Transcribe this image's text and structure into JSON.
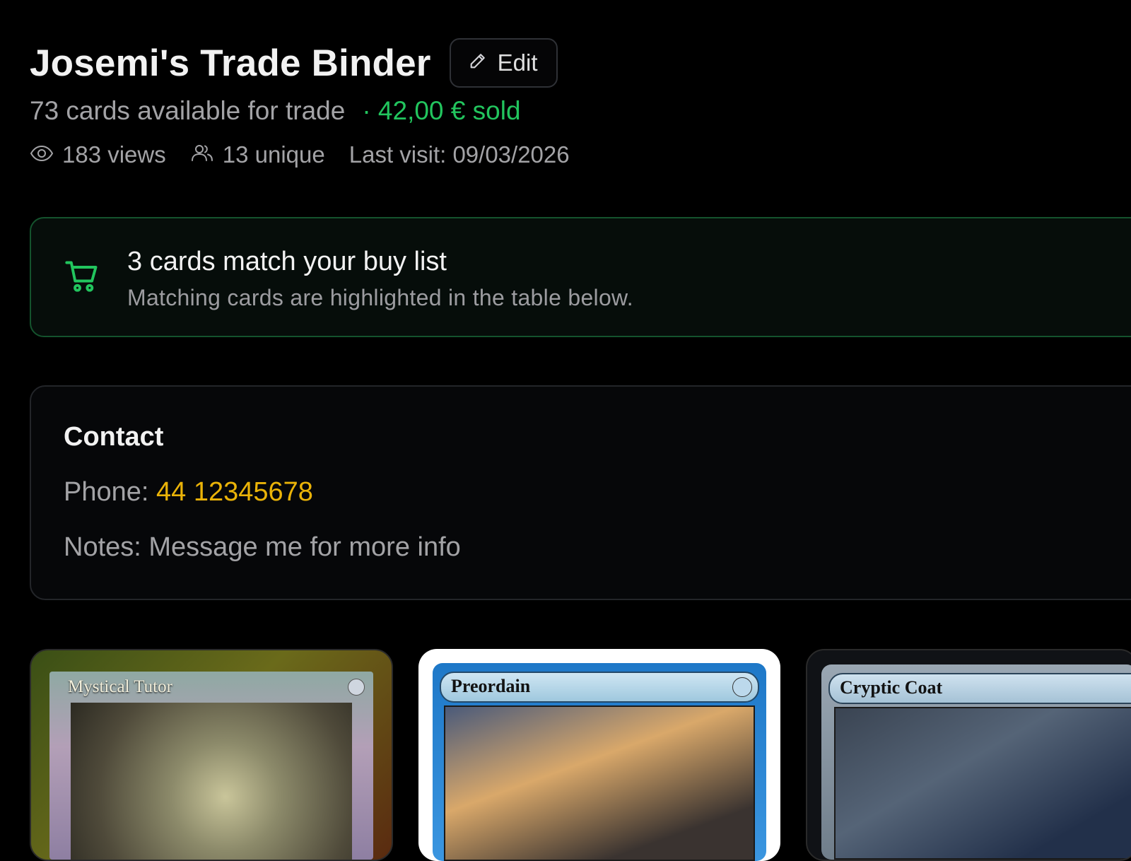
{
  "header": {
    "title": "Josemi's Trade Binder",
    "edit_label": "Edit",
    "available_text": "73 cards available for trade",
    "sold_text": "· 42,00 € sold"
  },
  "stats": {
    "views": "183 views",
    "unique": "13 unique",
    "last_visit": "Last visit: 09/03/2026"
  },
  "buy_list_match": {
    "title": "3 cards match your buy list",
    "subtitle": "Matching cards are highlighted in the table below."
  },
  "contact": {
    "heading": "Contact",
    "phone_label": "Phone:",
    "phone_value": "44 12345678",
    "notes_label": "Notes:",
    "notes_value": "Message me for more info"
  },
  "cards": [
    {
      "name": "Mystical Tutor"
    },
    {
      "name": "Preordain"
    },
    {
      "name": "Cryptic Coat"
    }
  ],
  "colors": {
    "accent_green": "#22c55e",
    "phone_yellow": "#eab308",
    "background": "#000000"
  },
  "icons": [
    "pencil-icon",
    "eye-icon",
    "users-icon",
    "cart-icon",
    "mana-symbol-icon"
  ]
}
